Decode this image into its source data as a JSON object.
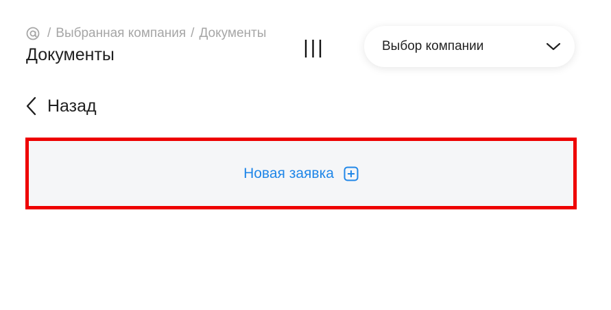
{
  "breadcrumb": {
    "home_icon": "at-sign-icon",
    "separator": "/",
    "items": [
      "Выбранная компания",
      "Документы"
    ]
  },
  "page_title": "Документы",
  "header": {
    "menu_icon": "menu-bars-icon",
    "company_select": {
      "label": "Выбор компании",
      "icon": "chevron-down-icon"
    }
  },
  "back": {
    "label": "Назад",
    "icon": "chevron-left-icon"
  },
  "new_request": {
    "label": "Новая заявка",
    "icon": "plus-square-icon",
    "accent_color": "#1f86e8",
    "highlight_color": "#ee0000"
  }
}
